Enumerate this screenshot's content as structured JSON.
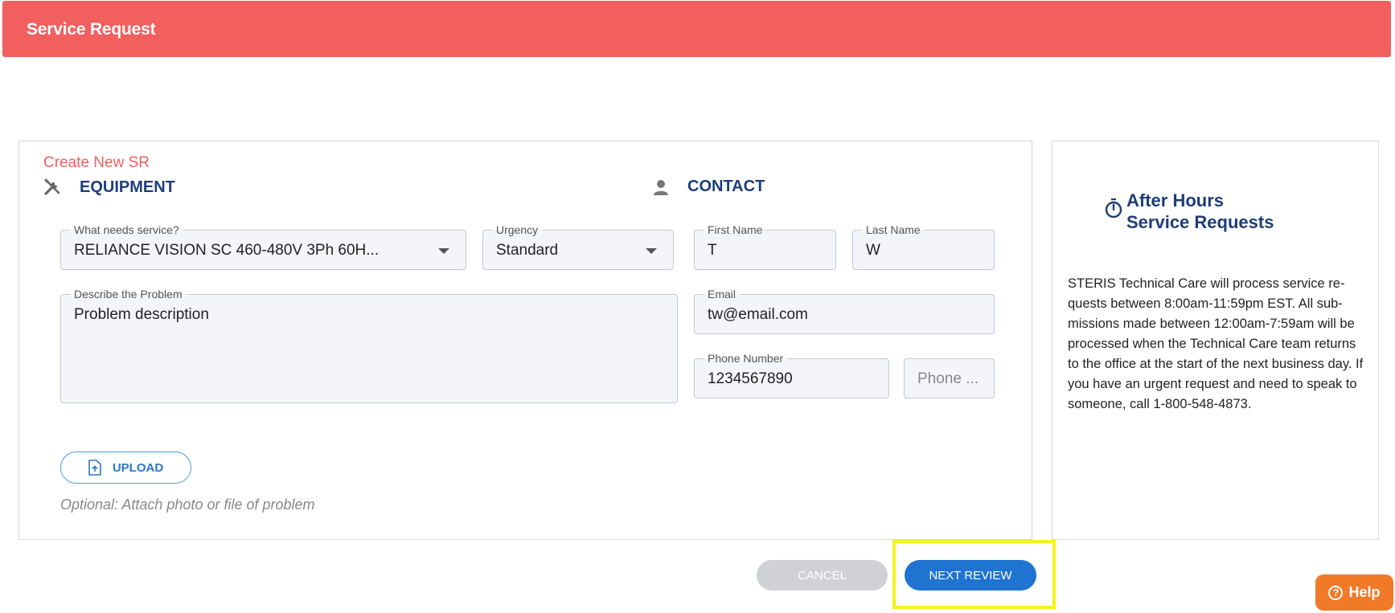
{
  "header": {
    "title": "Service Request"
  },
  "form": {
    "create_title": "Create New SR",
    "equipment_heading": "EQUIPMENT",
    "contact_heading": "CONTACT",
    "what_needs_service": {
      "label": "What needs service?",
      "value": "RELIANCE VISION SC 460-480V 3Ph 60H..."
    },
    "urgency": {
      "label": "Urgency",
      "value": "Standard"
    },
    "problem": {
      "label": "Describe the Problem",
      "value": "Problem description"
    },
    "first_name": {
      "label": "First Name",
      "value": "T"
    },
    "last_name": {
      "label": "Last Name",
      "value": "W"
    },
    "email": {
      "label": "Email",
      "value": "tw@email.com"
    },
    "phone": {
      "label": "Phone Number",
      "value": "1234567890"
    },
    "phone_ext": {
      "placeholder": "Phone ..."
    },
    "upload_label": "UPLOAD",
    "upload_hint": "Optional: Attach photo or file of problem"
  },
  "after_hours": {
    "title": "After Hours Service Requests",
    "body": "STERIS Technical Care will process service re-quests between 8:00am-11:59pm EST. All sub-missions made between 12:00am-7:59am will be processed when the Technical Care team returns to the office at the start of the next business day. If you have an urgent request and need to speak to someone, call 1-800-548-4873."
  },
  "actions": {
    "cancel_label": "CANCEL",
    "next_label": "NEXT REVIEW"
  },
  "help": {
    "label": "Help"
  },
  "colors": {
    "brand_red": "#f25f5f",
    "heading_navy": "#1d3d7a",
    "primary_blue": "#1f73d1",
    "help_orange": "#f07a27",
    "highlight_yellow": "#f3f31e"
  }
}
